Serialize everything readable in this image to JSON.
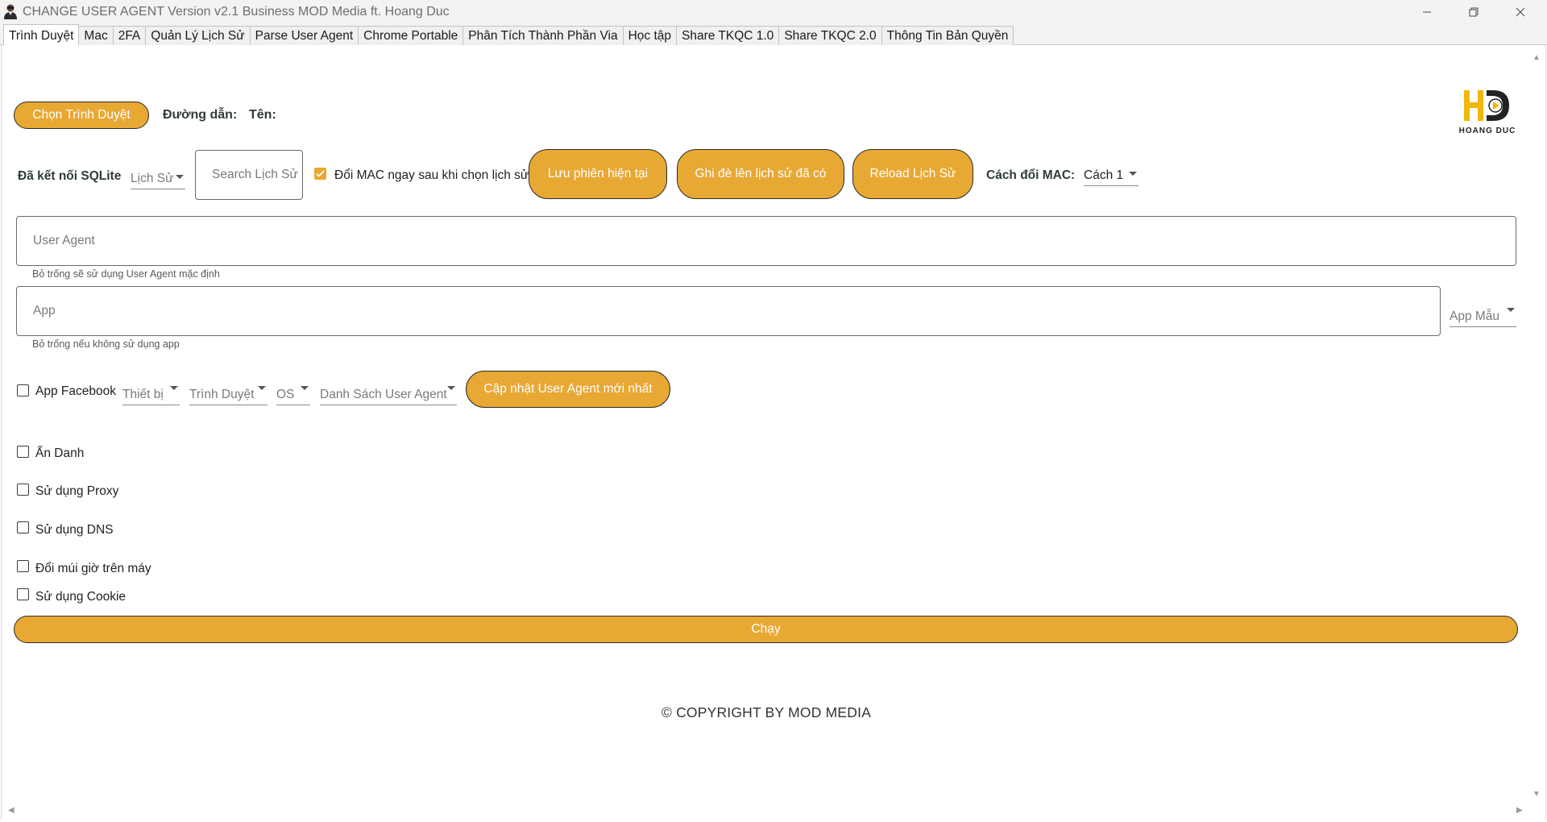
{
  "window": {
    "title": "CHANGE USER AGENT Version v2.1 Business MOD Media ft. Hoang Duc"
  },
  "tabs": [
    {
      "label": "Trình Duyệt",
      "active": true
    },
    {
      "label": "Mac"
    },
    {
      "label": "2FA"
    },
    {
      "label": "Quản Lý Lịch Sử"
    },
    {
      "label": "Parse User Agent"
    },
    {
      "label": "Chrome Portable"
    },
    {
      "label": "Phân Tích Thành Phần Via"
    },
    {
      "label": "Học tập"
    },
    {
      "label": "Share TKQC 1.0"
    },
    {
      "label": "Share TKQC 2.0"
    },
    {
      "label": "Thông Tin Bản Quyền"
    }
  ],
  "browser": {
    "choose_button": "Chọn Trình Duyệt",
    "path_label": "Đường dẫn:",
    "name_label": "Tên:"
  },
  "logo": {
    "text": "HOANG DUC"
  },
  "history": {
    "sqlite_status": "Đã kết nối SQLite",
    "history_combo": "Lịch Sử",
    "search_placeholder": "Search Lịch Sử",
    "change_mac_checkbox": "Đổi MAC ngay sau khi chọn lịch sử",
    "change_mac_checked": true,
    "save_session_button": "Lưu phiên hiện tại",
    "overwrite_button": "Ghi đè lên lịch sử đã có",
    "reload_button": "Reload Lịch Sử",
    "mac_method_label": "Cách đổi MAC:",
    "mac_method_value": "Cách 1"
  },
  "user_agent": {
    "placeholder": "User Agent",
    "hint": "Bỏ trống sẽ sử dụng User Agent mặc định"
  },
  "app": {
    "placeholder": "App",
    "hint": "Bỏ trống nếu không sử dụng app",
    "template_combo": "App Mẫu"
  },
  "filters": {
    "app_facebook": "App Facebook",
    "device": "Thiết bị",
    "browser": "Trình Duyệt",
    "os": "OS",
    "ua_list": "Danh Sách User Agent",
    "update_button": "Cập nhật User Agent mới nhất"
  },
  "options": [
    {
      "label": "Ẩn Danh",
      "checked": false
    },
    {
      "label": "Sử dụng Proxy",
      "checked": false
    },
    {
      "label": "Sử dụng DNS",
      "checked": false
    },
    {
      "label": "Đổi múi giờ trên máy",
      "checked": false
    },
    {
      "label": "Sử dụng Cookie",
      "checked": false
    }
  ],
  "run_button": "Chạy",
  "copyright": "© COPYRIGHT BY MOD MEDIA",
  "colors": {
    "accent": "#e8a834",
    "logo_yellow": "#f2b705",
    "logo_dark": "#222222"
  }
}
